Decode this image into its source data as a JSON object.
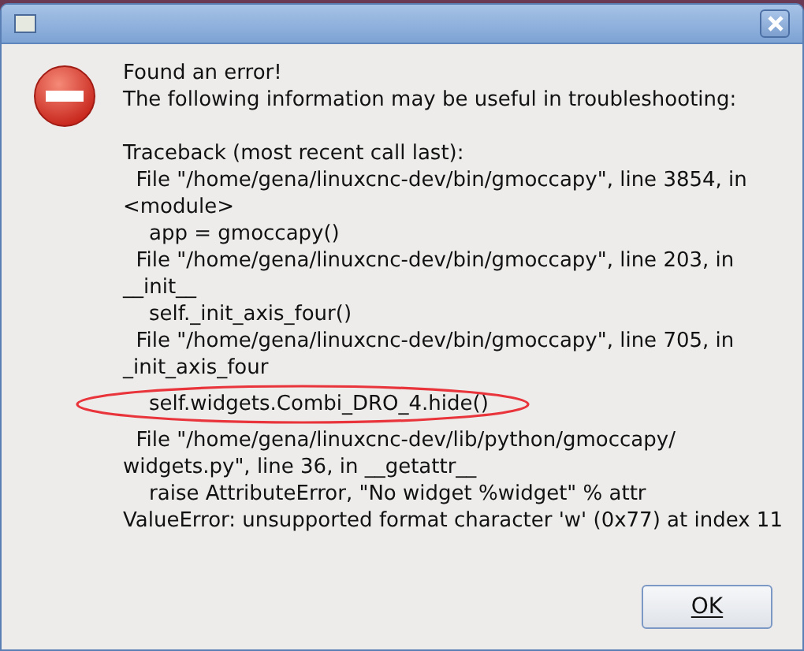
{
  "dialog": {
    "heading": "Found an error!",
    "intro": "The following information may be useful in troubleshooting:",
    "traceback": [
      "Traceback (most recent call last):",
      "  File \"/home/gena/linuxcnc-dev/bin/gmoccapy\", line 3854, in",
      "<module>",
      "    app = gmoccapy()",
      "  File \"/home/gena/linuxcnc-dev/bin/gmoccapy\", line 203, in",
      "__init__",
      "    self._init_axis_four()",
      "  File \"/home/gena/linuxcnc-dev/bin/gmoccapy\", line 705, in",
      "_init_axis_four",
      {
        "text": "    self.widgets.Combi_DRO_4.hide()",
        "circled": true
      },
      "  File \"/home/gena/linuxcnc-dev/lib/python/gmoccapy/",
      "widgets.py\", line 36, in __getattr__",
      "    raise AttributeError, \"No widget %widget\" % attr",
      "ValueError: unsupported format character 'w' (0x77) at index 11"
    ],
    "button": "OK"
  }
}
